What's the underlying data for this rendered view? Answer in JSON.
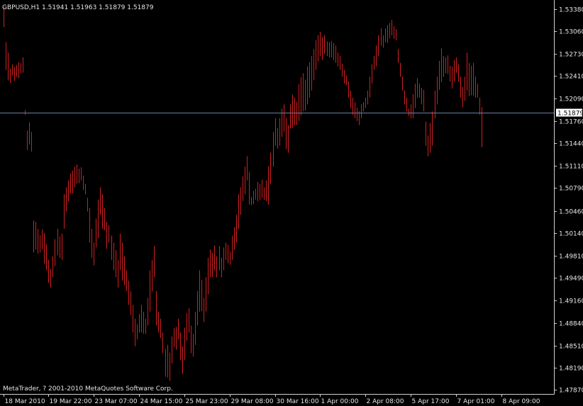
{
  "window": {
    "symbol_info": "GBPUSD,H1  1.51941 1.51963 1.51879 1.51879",
    "copyright": "MetaTrader, ? 2001-2010 MetaQuotes Software Corp."
  },
  "colors": {
    "background": "#000000",
    "bar": "#d02020",
    "text": "#e6e6e6",
    "axis": "#d0d0d0",
    "bid_line": "#7080a0",
    "bid_label_bg": "#ffffff"
  },
  "chart_data": {
    "type": "ohlc",
    "ylim": [
      1.4781,
      1.5349
    ],
    "bid": 1.51879,
    "bid_label": "1.51879",
    "yticks": [
      {
        "value": 1.5338,
        "label": "1.53380"
      },
      {
        "value": 1.5306,
        "label": "1.53060"
      },
      {
        "value": 1.5273,
        "label": "1.52730"
      },
      {
        "value": 1.5241,
        "label": "1.52410"
      },
      {
        "value": 1.5209,
        "label": "1.52090"
      },
      {
        "value": 1.5176,
        "label": "1.51760"
      },
      {
        "value": 1.5144,
        "label": "1.51440"
      },
      {
        "value": 1.5111,
        "label": "1.51110"
      },
      {
        "value": 1.5079,
        "label": "1.50790"
      },
      {
        "value": 1.5046,
        "label": "1.50460"
      },
      {
        "value": 1.5014,
        "label": "1.50140"
      },
      {
        "value": 1.4981,
        "label": "1.49810"
      },
      {
        "value": 1.4949,
        "label": "1.49490"
      },
      {
        "value": 1.4916,
        "label": "1.49160"
      },
      {
        "value": 1.4884,
        "label": "1.48840"
      },
      {
        "value": 1.4851,
        "label": "1.48510"
      },
      {
        "value": 1.4819,
        "label": "1.48190"
      },
      {
        "value": 1.4787,
        "label": "1.47870"
      }
    ],
    "xticks": [
      {
        "index": 0,
        "label": "18 Mar 2010"
      },
      {
        "index": 21,
        "label": "19 Mar 22:00"
      },
      {
        "index": 42,
        "label": "23 Mar 07:00"
      },
      {
        "index": 63,
        "label": "24 Mar 15:00"
      },
      {
        "index": 84,
        "label": "25 Mar 23:00"
      },
      {
        "index": 105,
        "label": "29 Mar 08:00"
      },
      {
        "index": 126,
        "label": "30 Mar 16:00"
      },
      {
        "index": 147,
        "label": "1 Apr 00:00"
      },
      {
        "index": 168,
        "label": "2 Apr 08:00"
      },
      {
        "index": 189,
        "label": "5 Apr 17:00"
      },
      {
        "index": 210,
        "label": "7 Apr 01:00"
      },
      {
        "index": 231,
        "label": "8 Apr 09:00"
      }
    ],
    "bars": [
      [
        1.5341,
        1.5312
      ],
      [
        1.529,
        1.525
      ],
      [
        1.5275,
        1.5235
      ],
      [
        1.5252,
        1.5231
      ],
      [
        1.5258,
        1.5242
      ],
      [
        1.5254,
        1.5234
      ],
      [
        1.5257,
        1.524
      ],
      [
        1.5261,
        1.5238
      ],
      [
        1.526,
        1.5245
      ],
      [
        1.5268,
        1.5246
      ],
      [
        1.5192,
        1.5185
      ],
      [
        1.5162,
        1.5134
      ],
      [
        1.5174,
        1.5142
      ],
      [
        1.516,
        1.5132
      ],
      [
        1.5032,
        1.4986
      ],
      [
        1.503,
        1.499
      ],
      [
        1.502,
        1.4984
      ],
      [
        1.5011,
        1.4986
      ],
      [
        1.5019,
        1.499
      ],
      [
        1.5014,
        1.497
      ],
      [
        1.4998,
        1.496
      ],
      [
        1.4975,
        1.4942
      ],
      [
        1.4962,
        1.4935
      ],
      [
        1.498,
        1.495
      ],
      [
        1.5005,
        1.4966
      ],
      [
        1.502,
        1.4982
      ],
      [
        1.5009,
        1.4978
      ],
      [
        1.5013,
        1.4975
      ],
      [
        1.507,
        1.502
      ],
      [
        1.508,
        1.5045
      ],
      [
        1.509,
        1.506
      ],
      [
        1.51,
        1.5071
      ],
      [
        1.5104,
        1.5071
      ],
      [
        1.511,
        1.508
      ],
      [
        1.5113,
        1.5085
      ],
      [
        1.5107,
        1.5086
      ],
      [
        1.5109,
        1.509
      ],
      [
        1.5097,
        1.5076
      ],
      [
        1.5085,
        1.507
      ],
      [
        1.5065,
        1.5045
      ],
      [
        1.505,
        1.5
      ],
      [
        1.502,
        1.4978
      ],
      [
        1.5,
        1.4967
      ],
      [
        1.5035,
        1.4993
      ],
      [
        1.5062,
        1.5006
      ],
      [
        1.508,
        1.504
      ],
      [
        1.507,
        1.502
      ],
      [
        1.505,
        1.5018
      ],
      [
        1.503,
        1.4991
      ],
      [
        1.5025,
        1.5
      ],
      [
        1.501,
        1.4975
      ],
      [
        1.5,
        1.496
      ],
      [
        1.4989,
        1.495
      ],
      [
        1.4975,
        1.4935
      ],
      [
        1.5013,
        1.496
      ],
      [
        1.5,
        1.4945
      ],
      [
        1.498,
        1.4938
      ],
      [
        1.496,
        1.493
      ],
      [
        1.4945,
        1.491
      ],
      [
        1.493,
        1.4895
      ],
      [
        1.491,
        1.487
      ],
      [
        1.489,
        1.485
      ],
      [
        1.4882,
        1.486
      ],
      [
        1.4897,
        1.487
      ],
      [
        1.491,
        1.487
      ],
      [
        1.49,
        1.4868
      ],
      [
        1.489,
        1.4868
      ],
      [
        1.492,
        1.488
      ],
      [
        1.496,
        1.49
      ],
      [
        1.4975,
        1.4929
      ],
      [
        1.4995,
        1.495
      ],
      [
        1.493,
        1.488
      ],
      [
        1.49,
        1.487
      ],
      [
        1.489,
        1.4862
      ],
      [
        1.487,
        1.484
      ],
      [
        1.4846,
        1.4806
      ],
      [
        1.4852,
        1.4805
      ],
      [
        1.4841,
        1.48
      ],
      [
        1.4864,
        1.4825
      ],
      [
        1.4876,
        1.4849
      ],
      [
        1.4878,
        1.4845
      ],
      [
        1.489,
        1.486
      ],
      [
        1.487,
        1.483
      ],
      [
        1.485,
        1.481
      ],
      [
        1.4877,
        1.483
      ],
      [
        1.4898,
        1.4858
      ],
      [
        1.4905,
        1.487
      ],
      [
        1.488,
        1.484
      ],
      [
        1.4868,
        1.4835
      ],
      [
        1.49,
        1.4852
      ],
      [
        1.493,
        1.488
      ],
      [
        1.496,
        1.49
      ],
      [
        1.4946,
        1.4901
      ],
      [
        1.492,
        1.4885
      ],
      [
        1.495,
        1.49
      ],
      [
        1.4978,
        1.4925
      ],
      [
        1.499,
        1.495
      ],
      [
        1.4985,
        1.495
      ],
      [
        1.4996,
        1.496
      ],
      [
        1.498,
        1.495
      ],
      [
        1.4995,
        1.496
      ],
      [
        1.4978,
        1.495
      ],
      [
        1.4993,
        1.496
      ],
      [
        1.5,
        1.4975
      ],
      [
        1.4997,
        1.497
      ],
      [
        1.4987,
        1.4968
      ],
      [
        1.501,
        1.4975
      ],
      [
        1.5022,
        1.499
      ],
      [
        1.504,
        1.5
      ],
      [
        1.507,
        1.502
      ],
      [
        1.508,
        1.504
      ],
      [
        1.5096,
        1.506
      ],
      [
        1.511,
        1.507
      ],
      [
        1.5125,
        1.509
      ],
      [
        1.5102,
        1.5055
      ],
      [
        1.5066,
        1.5054
      ],
      [
        1.5075,
        1.5056
      ],
      [
        1.5078,
        1.5062
      ],
      [
        1.5088,
        1.506
      ],
      [
        1.5085,
        1.5062
      ],
      [
        1.5091,
        1.5065
      ],
      [
        1.508,
        1.5062
      ],
      [
        1.509,
        1.506
      ],
      [
        1.511,
        1.5055
      ],
      [
        1.513,
        1.5085
      ],
      [
        1.516,
        1.511
      ],
      [
        1.518,
        1.514
      ],
      [
        1.5166,
        1.5136
      ],
      [
        1.518,
        1.514
      ],
      [
        1.5194,
        1.5153
      ],
      [
        1.52,
        1.516
      ],
      [
        1.518,
        1.5135
      ],
      [
        1.517,
        1.513
      ],
      [
        1.52,
        1.5165
      ],
      [
        1.5214,
        1.5166
      ],
      [
        1.521,
        1.517
      ],
      [
        1.5204,
        1.517
      ],
      [
        1.5229,
        1.5176
      ],
      [
        1.5239,
        1.5184
      ],
      [
        1.5245,
        1.519
      ],
      [
        1.5236,
        1.5191
      ],
      [
        1.5255,
        1.52
      ],
      [
        1.5261,
        1.521
      ],
      [
        1.527,
        1.522
      ],
      [
        1.528,
        1.5235
      ],
      [
        1.5293,
        1.525
      ],
      [
        1.53,
        1.5262
      ],
      [
        1.5305,
        1.527
      ],
      [
        1.5297,
        1.5264
      ],
      [
        1.53,
        1.5273
      ],
      [
        1.5291,
        1.527
      ],
      [
        1.529,
        1.5268
      ],
      [
        1.5292,
        1.5268
      ],
      [
        1.5289,
        1.5264
      ],
      [
        1.5285,
        1.526
      ],
      [
        1.5275,
        1.5255
      ],
      [
        1.527,
        1.525
      ],
      [
        1.5259,
        1.524
      ],
      [
        1.525,
        1.523
      ],
      [
        1.5242,
        1.5228
      ],
      [
        1.5233,
        1.521
      ],
      [
        1.522,
        1.5195
      ],
      [
        1.521,
        1.5185
      ],
      [
        1.5203,
        1.518
      ],
      [
        1.5195,
        1.5176
      ],
      [
        1.519,
        1.517
      ],
      [
        1.52,
        1.518
      ],
      [
        1.5203,
        1.519
      ],
      [
        1.521,
        1.5195
      ],
      [
        1.522,
        1.52
      ],
      [
        1.524,
        1.521
      ],
      [
        1.5258,
        1.523
      ],
      [
        1.527,
        1.525
      ],
      [
        1.5285,
        1.5255
      ],
      [
        1.53,
        1.527
      ],
      [
        1.531,
        1.5285
      ],
      [
        1.53,
        1.5282
      ],
      [
        1.531,
        1.529
      ],
      [
        1.5315,
        1.5289
      ],
      [
        1.5318,
        1.5296
      ],
      [
        1.5322,
        1.53
      ],
      [
        1.5313,
        1.5295
      ],
      [
        1.5309,
        1.5293
      ],
      [
        1.528,
        1.526
      ],
      [
        1.526,
        1.524
      ],
      [
        1.524,
        1.522
      ],
      [
        1.522,
        1.52
      ],
      [
        1.521,
        1.519
      ],
      [
        1.5194,
        1.5183
      ],
      [
        1.52,
        1.518
      ],
      [
        1.5215,
        1.518
      ],
      [
        1.523,
        1.5195
      ],
      [
        1.5238,
        1.5209
      ],
      [
        1.523,
        1.521
      ],
      [
        1.5224,
        1.52
      ],
      [
        1.5221,
        1.519
      ],
      [
        1.5175,
        1.514
      ],
      [
        1.5155,
        1.5125
      ],
      [
        1.5173,
        1.513
      ],
      [
        1.519,
        1.514
      ],
      [
        1.522,
        1.518
      ],
      [
        1.524,
        1.52
      ],
      [
        1.5263,
        1.5221
      ],
      [
        1.5281,
        1.5232
      ],
      [
        1.527,
        1.524
      ],
      [
        1.5268,
        1.5245
      ],
      [
        1.5271,
        1.5244
      ],
      [
        1.5256,
        1.5233
      ],
      [
        1.5255,
        1.5223
      ],
      [
        1.5264,
        1.5233
      ],
      [
        1.5268,
        1.5246
      ],
      [
        1.5258,
        1.5233
      ],
      [
        1.524,
        1.521
      ],
      [
        1.5225,
        1.5196
      ],
      [
        1.524,
        1.5205
      ],
      [
        1.5275,
        1.522
      ],
      [
        1.526,
        1.5212
      ],
      [
        1.5256,
        1.5213
      ],
      [
        1.526,
        1.5213
      ],
      [
        1.524,
        1.521
      ],
      [
        1.523,
        1.521
      ],
      [
        1.521,
        1.5185
      ],
      [
        1.5196,
        1.5138
      ]
    ]
  }
}
